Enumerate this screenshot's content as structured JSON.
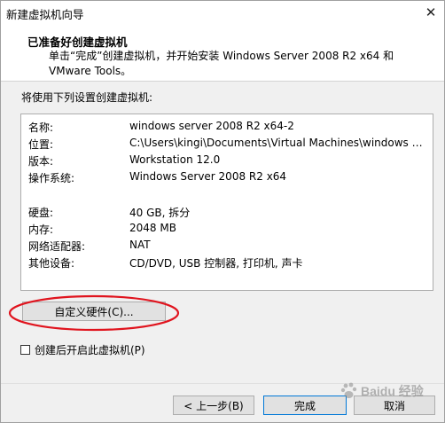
{
  "window": {
    "title": "新建虚拟机向导",
    "close_glyph": "✕"
  },
  "header": {
    "title": "已准备好创建虚拟机",
    "description": "单击“完成”创建虚拟机，并开始安装 Windows Server 2008 R2 x64 和 VMware Tools。"
  },
  "body": {
    "prompt": "将使用下列设置创建虚拟机:",
    "summary": [
      {
        "key": "名称:",
        "value": "windows server 2008 R2 x64-2"
      },
      {
        "key": "位置:",
        "value": "C:\\Users\\kingi\\Documents\\Virtual Machines\\windows ser..."
      },
      {
        "key": "版本:",
        "value": "Workstation 12.0"
      },
      {
        "key": "操作系统:",
        "value": "Windows Server 2008 R2 x64"
      },
      {
        "key": "硬盘:",
        "value": "40 GB, 拆分"
      },
      {
        "key": "内存:",
        "value": "2048 MB"
      },
      {
        "key": "网络适配器:",
        "value": "NAT"
      },
      {
        "key": "其他设备:",
        "value": "CD/DVD, USB 控制器, 打印机, 声卡"
      }
    ],
    "customize_button": "自定义硬件(C)...",
    "power_on_checkbox": {
      "label": "创建后开启此虚拟机(P)",
      "checked": false
    }
  },
  "footer": {
    "back_button": "< 上一步(B)",
    "finish_button": "完成",
    "cancel_button": "取消"
  },
  "annotation": {
    "ellipse_color": "#e0141e"
  },
  "watermark": {
    "text": "Baidu 经验"
  }
}
